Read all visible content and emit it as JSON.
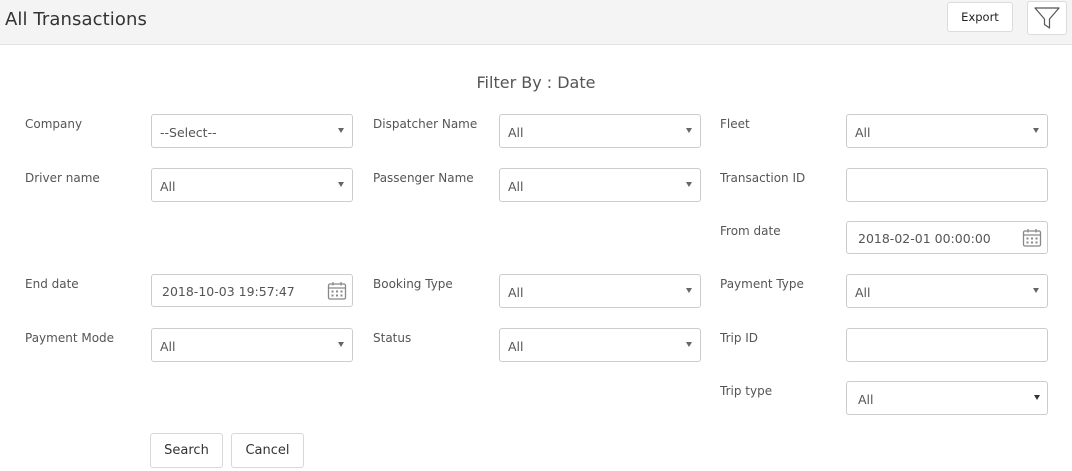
{
  "header": {
    "title": "All Transactions",
    "export_label": "Export",
    "filter_icon": "filter-funnel-icon"
  },
  "filter": {
    "title": "Filter By : Date",
    "company": {
      "label": "Company",
      "value": "--Select--"
    },
    "dispatcher_name": {
      "label": "Dispatcher Name",
      "value": "All"
    },
    "fleet": {
      "label": "Fleet",
      "value": "All"
    },
    "driver_name": {
      "label": "Driver name",
      "value": "All"
    },
    "passenger_name": {
      "label": "Passenger Name",
      "value": "All"
    },
    "transaction_id": {
      "label": "Transaction ID",
      "value": ""
    },
    "from_date": {
      "label": "From date",
      "value": "2018-02-01 00:00:00"
    },
    "end_date": {
      "label": "End date",
      "value": "2018-10-03 19:57:47"
    },
    "booking_type": {
      "label": "Booking Type",
      "value": "All"
    },
    "payment_type": {
      "label": "Payment Type",
      "value": "All"
    },
    "payment_mode": {
      "label": "Payment Mode",
      "value": "All"
    },
    "status": {
      "label": "Status",
      "value": "All"
    },
    "trip_id": {
      "label": "Trip ID",
      "value": ""
    },
    "trip_type": {
      "label": "Trip type",
      "value": "All"
    }
  },
  "actions": {
    "search_label": "Search",
    "cancel_label": "Cancel"
  },
  "colors": {
    "header_bg": "#f4f4f4",
    "border": "#cccccc",
    "text": "#555555"
  }
}
